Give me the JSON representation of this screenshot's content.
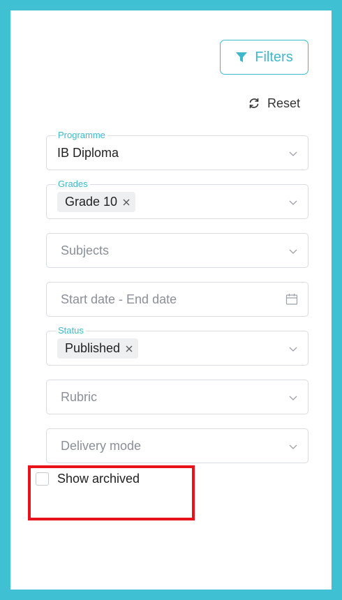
{
  "colors": {
    "accent": "#3fb8ca",
    "frame": "#3fc0d3",
    "highlight": "#e8131a"
  },
  "toolbar": {
    "filters_label": "Filters",
    "filters_icon": "funnel-icon",
    "reset_label": "Reset",
    "reset_icon": "refresh-icon"
  },
  "fields": {
    "programme": {
      "label": "Programme",
      "value": "IB Diploma"
    },
    "grades": {
      "label": "Grades",
      "chip": "Grade 10"
    },
    "subjects": {
      "placeholder": "Subjects"
    },
    "dates": {
      "placeholder": "Start date - End date",
      "icon": "calendar-icon"
    },
    "status": {
      "label": "Status",
      "chip": "Published"
    },
    "rubric": {
      "placeholder": "Rubric"
    },
    "delivery": {
      "placeholder": "Delivery mode"
    }
  },
  "archived": {
    "label": "Show archived",
    "checked": false
  }
}
